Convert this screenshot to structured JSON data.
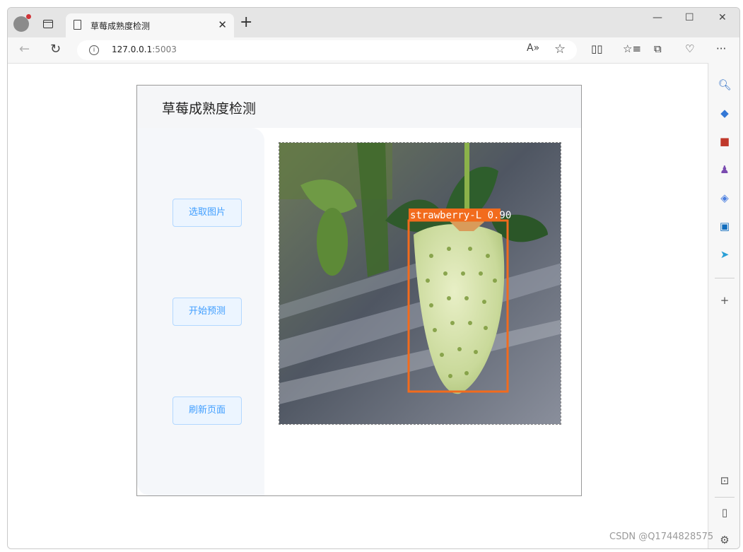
{
  "browser": {
    "tab": {
      "title": "草莓成熟度检测"
    },
    "address": {
      "host": "127.0.0.1",
      "port": ":5003"
    },
    "controls": {
      "minimize": "—",
      "maximize": "☐",
      "close": "✕",
      "new_tab": "+",
      "tab_close": "✕"
    },
    "toolbar_icons": [
      "split-screen-icon",
      "favorites-icon",
      "collections-icon",
      "browser-essentials-icon",
      "more-icon"
    ],
    "sidebar_icons": [
      "search-icon",
      "shopping-tag-icon",
      "tools-icon",
      "games-icon",
      "copilot-icon",
      "outlook-icon",
      "telegram-icon",
      "add-icon",
      "screenshot-icon",
      "sidebar-toggle-icon",
      "settings-icon"
    ]
  },
  "app": {
    "title": "草莓成熟度检测",
    "buttons": {
      "select_image": "选取图片",
      "start_predict": "开始预测",
      "refresh_page": "刷新页面"
    },
    "detection": {
      "label": "strawberry-L 0.90",
      "class": "strawberry-L",
      "confidence": 0.9,
      "box_color": "#f26b1d"
    },
    "accent_color": "#409eff"
  },
  "watermark": "CSDN @Q1744828575"
}
